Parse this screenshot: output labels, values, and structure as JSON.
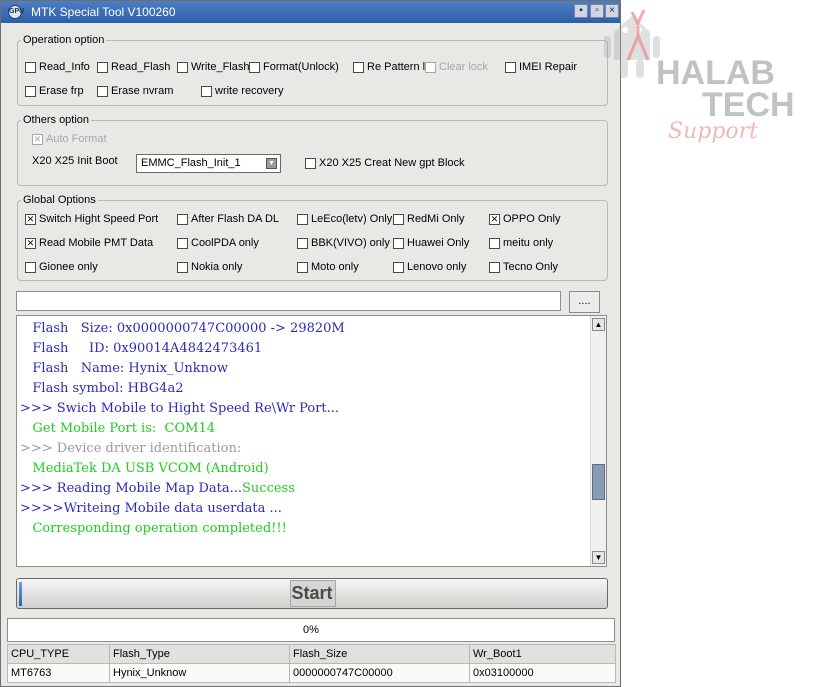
{
  "window": {
    "title": "MTK Special Tool V100260",
    "controls": {
      "minimize": "▪",
      "maximize": "▫",
      "close": "×"
    }
  },
  "operation_option": {
    "legend": "Operation option",
    "items": [
      {
        "label": "Read_Info",
        "checked": false,
        "enabled": true
      },
      {
        "label": "Read_Flash",
        "checked": false,
        "enabled": true
      },
      {
        "label": "Write_Flash",
        "checked": false,
        "enabled": true
      },
      {
        "label": "Format(Unlock)",
        "checked": false,
        "enabled": true
      },
      {
        "label": "Re Pattern l",
        "checked": false,
        "enabled": true
      },
      {
        "label": "Clear lock",
        "checked": false,
        "enabled": false
      },
      {
        "label": "IMEI Repair",
        "checked": false,
        "enabled": true
      },
      {
        "label": "Erase frp",
        "checked": false,
        "enabled": true
      },
      {
        "label": "Erase nvram",
        "checked": false,
        "enabled": true
      },
      {
        "label": "write recovery",
        "checked": false,
        "enabled": true
      }
    ]
  },
  "others_option": {
    "legend": "Others option",
    "auto_format": {
      "label": "Auto Format",
      "checked": true,
      "enabled": false
    },
    "init_boot_label": "X20 X25 Init Boot",
    "init_boot_value": "EMMC_Flash_Init_1",
    "new_gpt": {
      "label": "X20 X25 Creat New gpt Block",
      "checked": false,
      "enabled": true
    }
  },
  "global_options": {
    "legend": "Global Options",
    "items": [
      {
        "label": "Switch Hight Speed Port",
        "checked": true
      },
      {
        "label": "After Flash DA DL",
        "checked": false
      },
      {
        "label": "LeEco(letv) Only",
        "checked": false
      },
      {
        "label": "RedMi Only",
        "checked": false
      },
      {
        "label": "OPPO Only",
        "checked": true
      },
      {
        "label": "Read Mobile PMT Data",
        "checked": true
      },
      {
        "label": "CoolPDA only",
        "checked": false
      },
      {
        "label": "BBK(VIVO) only",
        "checked": false
      },
      {
        "label": "Huawei Only",
        "checked": false
      },
      {
        "label": "meitu only",
        "checked": false
      },
      {
        "label": "Gionee only",
        "checked": false
      },
      {
        "label": "Nokia only",
        "checked": false
      },
      {
        "label": "Moto only",
        "checked": false
      },
      {
        "label": "Lenovo only",
        "checked": false
      },
      {
        "label": "Tecno Only",
        "checked": false
      }
    ]
  },
  "file_path": {
    "value": "",
    "browse_label": "...."
  },
  "log": {
    "lines": [
      {
        "parts": [
          {
            "text": "   Flash   Size: 0x0000000747C00000 -> 29820M",
            "color": "blue"
          }
        ]
      },
      {
        "parts": [
          {
            "text": "   Flash     ID: 0x90014A4842473461",
            "color": "blue"
          }
        ]
      },
      {
        "parts": [
          {
            "text": "   Flash   Name: Hynix_Unknow",
            "color": "blue"
          }
        ]
      },
      {
        "parts": [
          {
            "text": "   Flash symbol: HBG4a2",
            "color": "blue"
          }
        ]
      },
      {
        "parts": [
          {
            "text": ">>> Swich Mobile to Hight Speed Re\\Wr Port...",
            "color": "blue"
          }
        ]
      },
      {
        "parts": [
          {
            "text": "   Get Mobile Port is:  COM14",
            "color": "green"
          }
        ]
      },
      {
        "parts": [
          {
            "text": ">>> Device driver identification:",
            "color": "gray"
          }
        ]
      },
      {
        "parts": [
          {
            "text": "   MediaTek DA USB VCOM (Android)",
            "color": "green"
          }
        ]
      },
      {
        "parts": [
          {
            "text": ">>> Reading Mobile Map Data...",
            "color": "blue"
          },
          {
            "text": "Success",
            "color": "green"
          }
        ]
      },
      {
        "parts": [
          {
            "text": ">>>>Writeing Mobile data userdata ...",
            "color": "blue"
          }
        ]
      },
      {
        "parts": [
          {
            "text": "   Corresponding operation completed!!!",
            "color": "green"
          }
        ]
      }
    ],
    "scroll_up": "▲",
    "scroll_down": "▼"
  },
  "start_button": {
    "label": "Start"
  },
  "progress": {
    "text": "0%",
    "value": 0
  },
  "info_table": {
    "headers": [
      "CPU_TYPE",
      "Flash_Type",
      "Flash_Size",
      "Wr_Boot1"
    ],
    "values": [
      "MT6763",
      "Hynix_Unknow",
      "0000000747C00000",
      "0x03100000"
    ]
  },
  "watermark": {
    "line1": "HALAB",
    "line2": "TECH",
    "line3": "Support"
  },
  "colors": {
    "log_blue": "#2b2bb8",
    "log_green": "#1fcc1f",
    "log_gray": "#9a9a9a",
    "title_bar": "#2d5fa8",
    "watermark_gray": "#a9a9a9",
    "watermark_red": "#e88a8a"
  }
}
